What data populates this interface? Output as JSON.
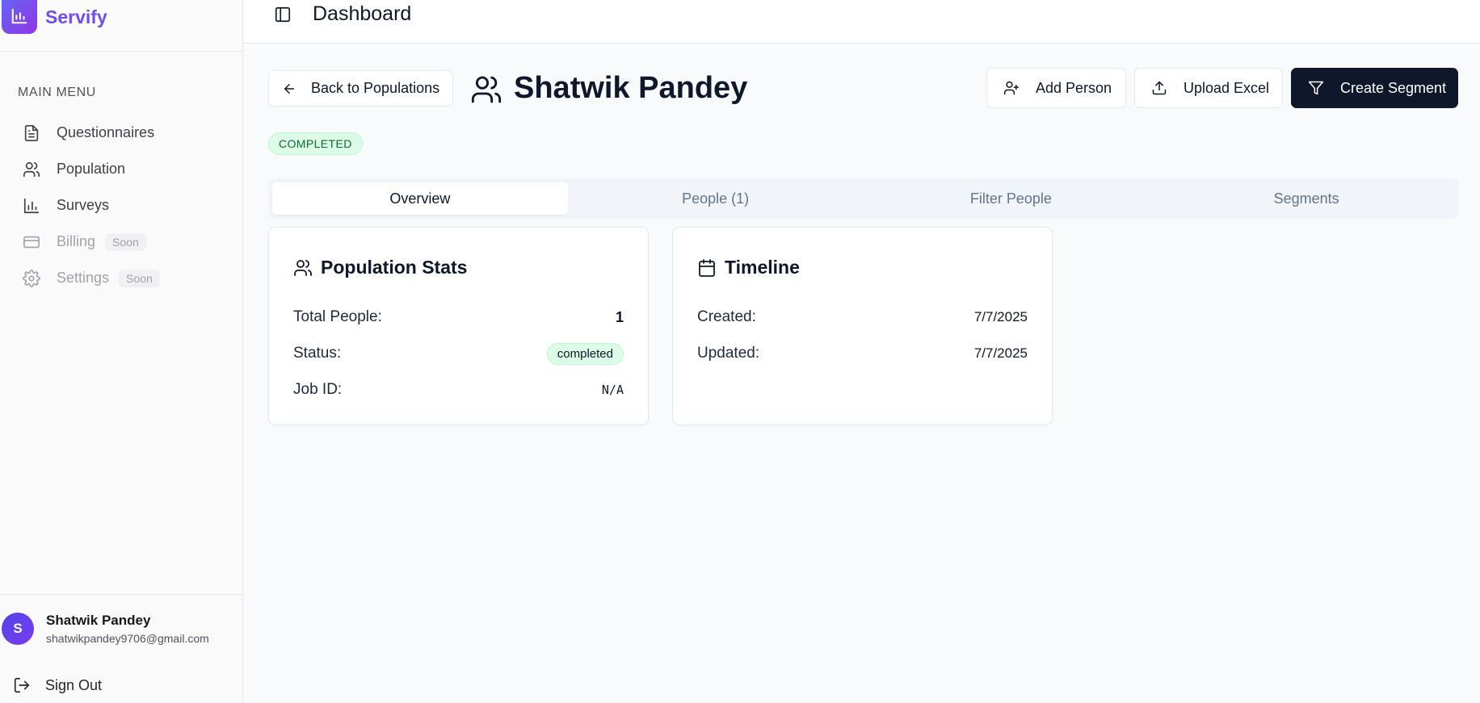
{
  "app": {
    "name": "Servify"
  },
  "topbar": {
    "title": "Dashboard"
  },
  "sidebar": {
    "heading": "MAIN MENU",
    "items": [
      {
        "label": "Questionnaires",
        "icon": "file-text-icon"
      },
      {
        "label": "Population",
        "icon": "users-icon"
      },
      {
        "label": "Surveys",
        "icon": "bar-chart-icon"
      },
      {
        "label": "Billing",
        "icon": "credit-card-icon",
        "badge": "Soon"
      },
      {
        "label": "Settings",
        "icon": "gear-icon",
        "badge": "Soon"
      }
    ],
    "user": {
      "initial": "S",
      "name": "Shatwik Pandey",
      "email": "shatwikpandey9706@gmail.com"
    },
    "signout_label": "Sign Out"
  },
  "header": {
    "back_label": "Back to Populations",
    "title": "Shatwik Pandey",
    "status": "COMPLETED",
    "actions": {
      "add": "Add Person",
      "upload": "Upload Excel",
      "segment": "Create Segment"
    }
  },
  "tabs": [
    {
      "label": "Overview",
      "active": true
    },
    {
      "label": "People (1)"
    },
    {
      "label": "Filter People"
    },
    {
      "label": "Segments"
    }
  ],
  "stats": {
    "title": "Population Stats",
    "total_label": "Total People:",
    "total_value": "1",
    "status_label": "Status:",
    "status_value": "completed",
    "job_label": "Job ID:",
    "job_value": "N/A"
  },
  "timeline": {
    "title": "Timeline",
    "created_label": "Created:",
    "created_value": "7/7/2025",
    "updated_label": "Updated:",
    "updated_value": "7/7/2025"
  },
  "colors": {
    "brand": "#6d4ef0",
    "primary": "#0f172a",
    "success_bg": "#dcfce7",
    "success_text": "#166534"
  }
}
